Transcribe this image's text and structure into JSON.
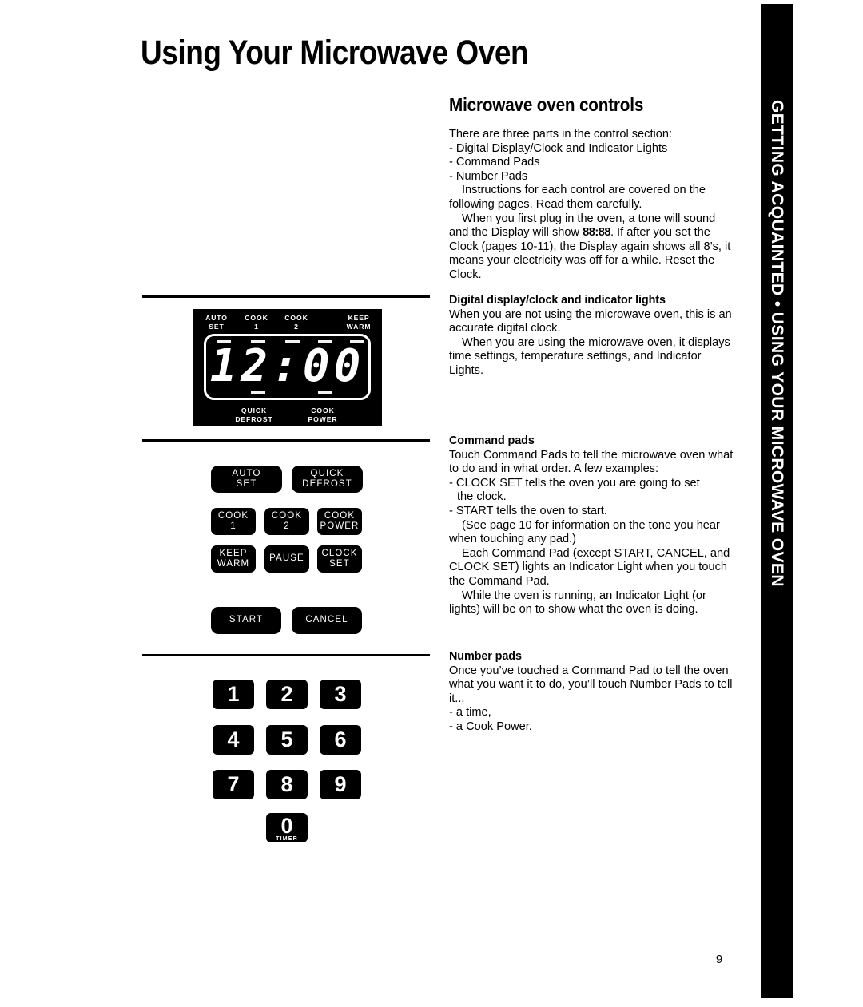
{
  "page": {
    "title": "Using Your Microwave Oven",
    "section_title": "Microwave oven controls",
    "page_number": "9",
    "thumb_tab": "GETTING ACQUAINTED • USING YOUR MICROWAVE OVEN"
  },
  "intro": {
    "line1": "There are three parts in the control section:",
    "bullet1": "- Digital Display/Clock and Indicator Lights",
    "bullet2": "- Command Pads",
    "bullet3": "- Number Pads",
    "para1": "Instructions for each control are covered on the following pages. Read them carefully.",
    "para2_a": "When you first plug in the oven, a tone will sound and the Display will show ",
    "para2_bold": "88:88",
    "para2_b": ". If after you set the Clock (pages 10-11), the Display again shows all 8’s, it means your electricity was off for a while. Reset the Clock."
  },
  "digital_display": {
    "heading": "Digital display/clock and indicator lights",
    "para1": "When you are not using the microwave oven, this is an accurate digital clock.",
    "para2": "When you are using the microwave oven, it displays time settings, temperature settings, and Indicator Lights."
  },
  "command_pads_text": {
    "heading": "Command pads",
    "para1": "Touch Command Pads to tell the microwave oven what to do and in what order. A few examples:",
    "bullet1": "- CLOCK SET tells the oven you are going to set",
    "bullet1_cont": "the clock.",
    "bullet2": "- START tells the oven to start.",
    "para2": "(See page 10 for information on the tone you hear when touching any pad.)",
    "para3": "Each Command Pad (except START, CANCEL, and CLOCK SET) lights an Indicator Light when you touch the Command Pad.",
    "para4": "While the oven is running, an Indicator Light (or lights) will be on to show what the oven is doing."
  },
  "number_pads_text": {
    "heading": "Number pads",
    "para1": "Once you’ve touched a Command Pad to tell the oven what you want it to do, you’ll touch Number Pads to tell it...",
    "bullet1": "- a time,",
    "bullet2": "- a Cook Power."
  },
  "display_illustration": {
    "indicators_top": [
      {
        "name": "auto-set",
        "label": "AUTO\nSET"
      },
      {
        "name": "cook-1",
        "label": "COOK\n1"
      },
      {
        "name": "cook-2",
        "label": "COOK\n2"
      },
      {
        "name": "keep-warm",
        "label": "KEEP\nWARM"
      }
    ],
    "indicators_bottom": [
      {
        "name": "quick-defrost",
        "label": "QUICK\nDEFROST"
      },
      {
        "name": "cook-power",
        "label": "COOK\nPOWER"
      }
    ],
    "clock_value": "12:00",
    "panel_color": "#000000",
    "digit_color": "#ffffff"
  },
  "command_pads": [
    {
      "name": "auto-set",
      "label": "AUTO\nSET"
    },
    {
      "name": "quick-defrost",
      "label": "QUICK\nDEFROST"
    },
    {
      "name": "cook-1",
      "label": "COOK\n1"
    },
    {
      "name": "cook-2",
      "label": "COOK\n2"
    },
    {
      "name": "cook-power",
      "label": "COOK\nPOWER"
    },
    {
      "name": "keep-warm",
      "label": "KEEP\nWARM"
    },
    {
      "name": "pause",
      "label": "PAUSE"
    },
    {
      "name": "clock-set",
      "label": "CLOCK\nSET"
    },
    {
      "name": "start",
      "label": "START"
    },
    {
      "name": "cancel",
      "label": "CANCEL"
    }
  ],
  "number_pads": [
    {
      "name": "1",
      "label": "1",
      "sub": ""
    },
    {
      "name": "2",
      "label": "2",
      "sub": ""
    },
    {
      "name": "3",
      "label": "3",
      "sub": ""
    },
    {
      "name": "4",
      "label": "4",
      "sub": ""
    },
    {
      "name": "5",
      "label": "5",
      "sub": ""
    },
    {
      "name": "6",
      "label": "6",
      "sub": ""
    },
    {
      "name": "7",
      "label": "7",
      "sub": ""
    },
    {
      "name": "8",
      "label": "8",
      "sub": ""
    },
    {
      "name": "9",
      "label": "9",
      "sub": ""
    },
    {
      "name": "0-timer",
      "label": "0",
      "sub": "TIMER"
    }
  ]
}
